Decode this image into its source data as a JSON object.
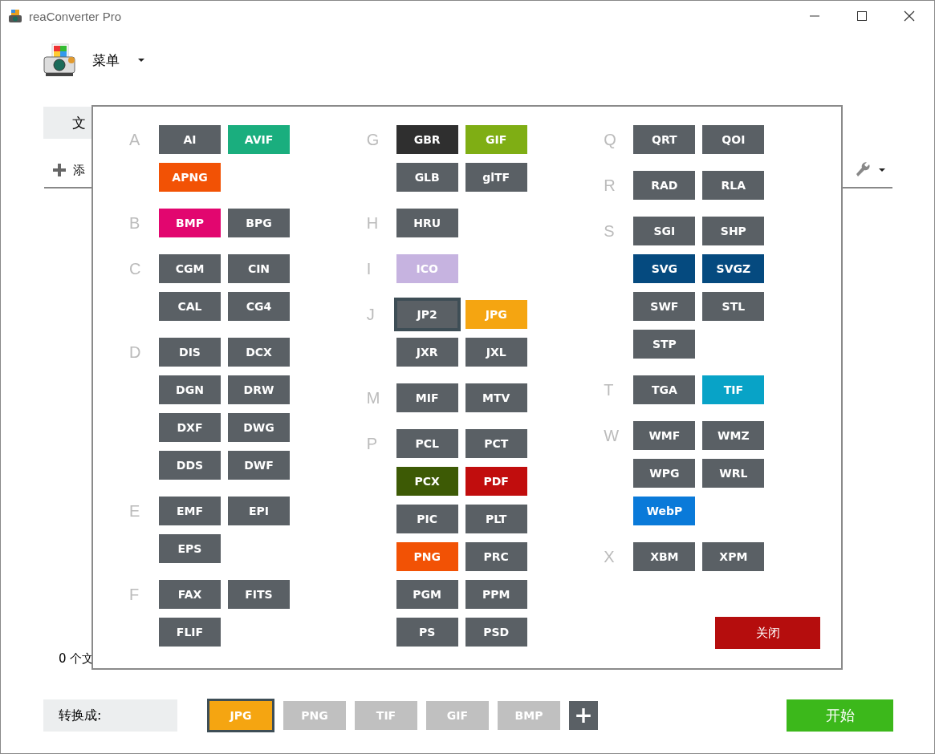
{
  "window": {
    "title": "reaConverter Pro"
  },
  "menu": {
    "label": "菜单"
  },
  "tab": {
    "label": "文"
  },
  "toolbar": {
    "add_label": "添"
  },
  "status": "0 个文",
  "format_dialog": {
    "columns": [
      [
        {
          "letter": "A",
          "formats": [
            {
              "label": "AI"
            },
            {
              "label": "AVIF",
              "color": "#1aae7e"
            },
            {
              "label": "APNG",
              "color": "#f25205"
            }
          ]
        },
        {
          "letter": "B",
          "formats": [
            {
              "label": "BMP",
              "color": "#e2066f"
            },
            {
              "label": "BPG"
            }
          ]
        },
        {
          "letter": "C",
          "formats": [
            {
              "label": "CGM"
            },
            {
              "label": "CIN"
            },
            {
              "label": "CAL"
            },
            {
              "label": "CG4"
            }
          ]
        },
        {
          "letter": "D",
          "formats": [
            {
              "label": "DIS"
            },
            {
              "label": "DCX"
            },
            {
              "label": "DGN"
            },
            {
              "label": "DRW"
            },
            {
              "label": "DXF"
            },
            {
              "label": "DWG"
            },
            {
              "label": "DDS"
            },
            {
              "label": "DWF"
            }
          ]
        },
        {
          "letter": "E",
          "formats": [
            {
              "label": "EMF"
            },
            {
              "label": "EPI"
            },
            {
              "label": "EPS"
            }
          ]
        },
        {
          "letter": "F",
          "formats": [
            {
              "label": "FAX"
            },
            {
              "label": "FITS"
            },
            {
              "label": "FLIF"
            }
          ]
        }
      ],
      [
        {
          "letter": "G",
          "formats": [
            {
              "label": "GBR",
              "color": "#2f2f2f"
            },
            {
              "label": "GIF",
              "color": "#7fae14"
            },
            {
              "label": "GLB"
            },
            {
              "label": "glTF"
            }
          ]
        },
        {
          "letter": "H",
          "formats": [
            {
              "label": "HRU"
            }
          ]
        },
        {
          "letter": "I",
          "formats": [
            {
              "label": "ICO",
              "color": "#c6b3e0"
            }
          ]
        },
        {
          "letter": "J",
          "formats": [
            {
              "label": "JP2",
              "focused": true
            },
            {
              "label": "JPG",
              "color": "#f5a511"
            },
            {
              "label": "JXR"
            },
            {
              "label": "JXL"
            }
          ]
        },
        {
          "letter": "M",
          "formats": [
            {
              "label": "MIF"
            },
            {
              "label": "MTV"
            }
          ]
        },
        {
          "letter": "P",
          "formats": [
            {
              "label": "PCL"
            },
            {
              "label": "PCT"
            },
            {
              "label": "PCX",
              "color": "#3d5a05"
            },
            {
              "label": "PDF",
              "color": "#c10d0d"
            },
            {
              "label": "PIC"
            },
            {
              "label": "PLT"
            },
            {
              "label": "PNG",
              "color": "#f25205"
            },
            {
              "label": "PRC"
            },
            {
              "label": "PGM"
            },
            {
              "label": "PPM"
            },
            {
              "label": "PS"
            },
            {
              "label": "PSD"
            }
          ]
        }
      ],
      [
        {
          "letter": "Q",
          "formats": [
            {
              "label": "QRT"
            },
            {
              "label": "QOI"
            }
          ]
        },
        {
          "letter": "R",
          "formats": [
            {
              "label": "RAD"
            },
            {
              "label": "RLA"
            }
          ]
        },
        {
          "letter": "S",
          "formats": [
            {
              "label": "SGI"
            },
            {
              "label": "SHP"
            },
            {
              "label": "SVG",
              "color": "#054a7f"
            },
            {
              "label": "SVGZ",
              "color": "#054a7f"
            },
            {
              "label": "SWF"
            },
            {
              "label": "STL"
            },
            {
              "label": "STP"
            }
          ]
        },
        {
          "letter": "T",
          "formats": [
            {
              "label": "TGA"
            },
            {
              "label": "TIF",
              "color": "#08a3c7"
            }
          ]
        },
        {
          "letter": "W",
          "formats": [
            {
              "label": "WMF"
            },
            {
              "label": "WMZ"
            },
            {
              "label": "WPG"
            },
            {
              "label": "WRL"
            },
            {
              "label": "WebP",
              "color": "#0a7ad9"
            }
          ]
        },
        {
          "letter": "X",
          "formats": [
            {
              "label": "XBM"
            },
            {
              "label": "XPM"
            }
          ]
        }
      ]
    ],
    "close_button": "关闭"
  },
  "convert_bar": {
    "label": "转换成:",
    "formats": [
      {
        "label": "JPG",
        "selected": true
      },
      {
        "label": "PNG",
        "selected": false
      },
      {
        "label": "TIF",
        "selected": false
      },
      {
        "label": "GIF",
        "selected": false
      },
      {
        "label": "BMP",
        "selected": false
      }
    ],
    "add_button": "+"
  },
  "start_button": "开始"
}
